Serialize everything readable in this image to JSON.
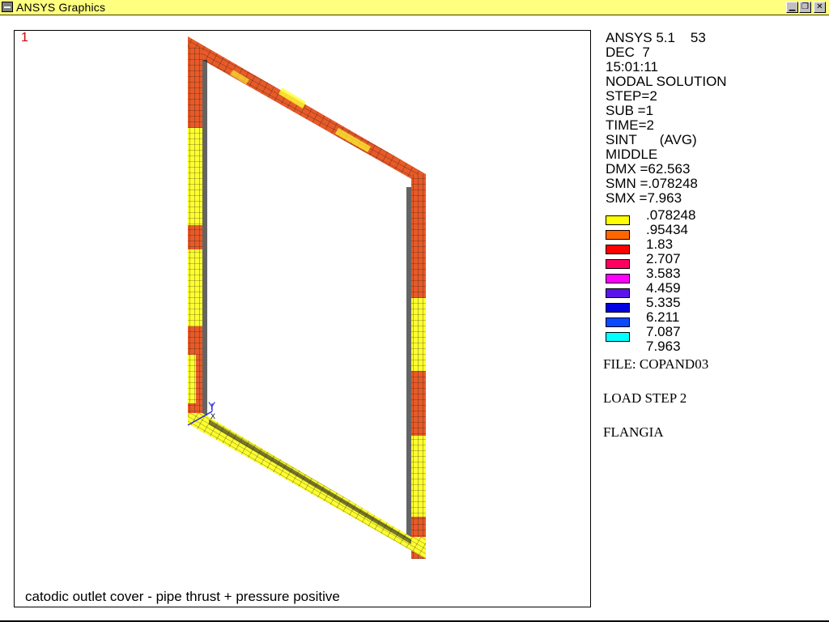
{
  "window": {
    "title": "ANSYS Graphics",
    "controls": {
      "minimize": "▁",
      "restore": "❐",
      "close": "✕"
    }
  },
  "viewport": {
    "window_number": "1",
    "caption": "catodic outlet cover - pipe thrust + pressure positive",
    "triad_label_y": "Y",
    "triad_label_x": "X"
  },
  "info": {
    "lines": [
      "ANSYS 5.1    53",
      "DEC  7",
      "15:01:11",
      "NODAL SOLUTION",
      "STEP=2",
      "SUB =1",
      "TIME=2",
      "SINT      (AVG)",
      "MIDDLE",
      "DMX =62.563",
      "SMN =.078248",
      "SMX =7.963"
    ]
  },
  "legend": {
    "values": [
      ".078248",
      ".95434",
      "1.83",
      "2.707",
      "3.583",
      "4.459",
      "5.335",
      "6.211",
      "7.087",
      "7.963"
    ],
    "colors": [
      "#ffff00",
      "#ff6600",
      "#ff0000",
      "#ff0060",
      "#ff00ff",
      "#5a16e8",
      "#0000e0",
      "#0a4bff",
      "#00ffff"
    ]
  },
  "meta": {
    "file": "FILE: COPAND03",
    "load_step": "LOAD STEP 2",
    "name": "FLANGIA"
  },
  "colors": {
    "titlebar": "#ffff80",
    "stress_low": "#ffff00",
    "stress_mid": "#e85020",
    "mesh": "#202020"
  }
}
